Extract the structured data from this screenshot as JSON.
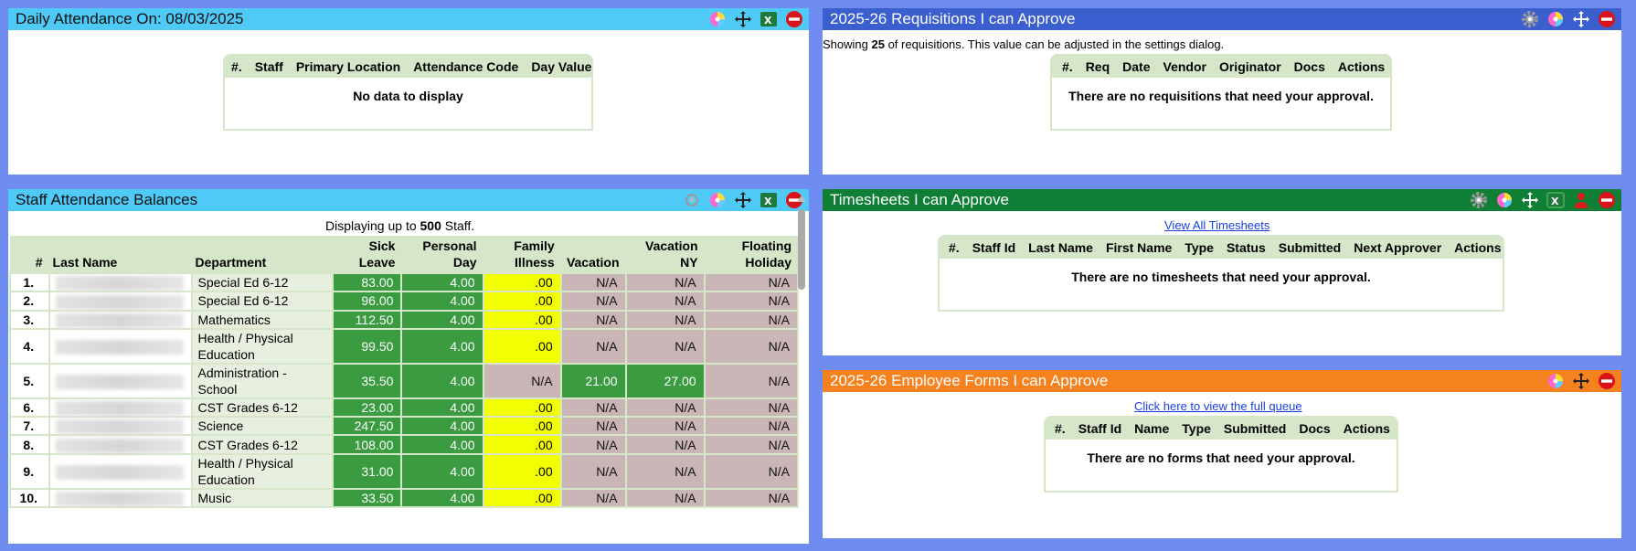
{
  "colors": {
    "frame": "#6f8df0",
    "cyan_header": "#4fc9f5",
    "blue_header": "#3b5fcf",
    "green_header": "#0f7f35",
    "orange_header": "#f5811f",
    "cell_green": "#3a9b41",
    "cell_yellow": "#f2ff00",
    "cell_mauve": "#c9b5b5",
    "table_header": "#d5e6c9"
  },
  "daily": {
    "title": "Daily Attendance On: 08/03/2025",
    "columns": [
      "#.",
      "Staff",
      "Primary Location",
      "Attendance Code",
      "Day Value"
    ],
    "empty": "No data to display",
    "icons": [
      "palette-icon",
      "move-icon",
      "excel-icon",
      "remove-icon"
    ]
  },
  "requisitions": {
    "title": "2025-26 Requisitions I can Approve",
    "note_prefix": "Showing ",
    "note_count": "25",
    "note_suffix": " of requisitions. This value can be adjusted in the settings dialog.",
    "columns": [
      "#.",
      "Req",
      "Date",
      "Vendor",
      "Originator",
      "Docs",
      "Actions"
    ],
    "empty": "There are no requisitions that need your approval.",
    "icons": [
      "gear-icon",
      "palette-icon",
      "move-icon",
      "remove-icon"
    ]
  },
  "balances": {
    "title": "Staff Attendance Balances",
    "note_prefix": "Displaying up to ",
    "note_count": "500",
    "note_suffix": " Staff.",
    "headers": {
      "num": "#",
      "last_name": "Last Name",
      "department": "Department",
      "sick_1": "Sick",
      "sick_2": "Leave",
      "personal_1": "Personal",
      "personal_2": "Day",
      "family_1": "Family",
      "family_2": "Illness",
      "vacation": "Vacation",
      "vac_ny_1": "Vacation",
      "vac_ny_2": "NY",
      "floating_1": "Floating",
      "floating_2": "Holiday"
    },
    "rows": [
      {
        "num": "1.",
        "dept": "Special Ed 6-12",
        "sick": "83.00",
        "personal": "4.00",
        "family": ".00",
        "vacation": "N/A",
        "vac_ny": "N/A",
        "floating": "N/A"
      },
      {
        "num": "2.",
        "dept": "Special Ed 6-12",
        "sick": "96.00",
        "personal": "4.00",
        "family": ".00",
        "vacation": "N/A",
        "vac_ny": "N/A",
        "floating": "N/A"
      },
      {
        "num": "3.",
        "dept": "Mathematics",
        "sick": "112.50",
        "personal": "4.00",
        "family": ".00",
        "vacation": "N/A",
        "vac_ny": "N/A",
        "floating": "N/A"
      },
      {
        "num": "4.",
        "dept": "Health / Physical Education",
        "sick": "99.50",
        "personal": "4.00",
        "family": ".00",
        "vacation": "N/A",
        "vac_ny": "N/A",
        "floating": "N/A"
      },
      {
        "num": "5.",
        "dept": "Administration - School",
        "sick": "35.50",
        "personal": "4.00",
        "family": "N/A",
        "vacation": "21.00",
        "vac_ny": "27.00",
        "floating": "N/A"
      },
      {
        "num": "6.",
        "dept": "CST Grades 6-12",
        "sick": "23.00",
        "personal": "4.00",
        "family": ".00",
        "vacation": "N/A",
        "vac_ny": "N/A",
        "floating": "N/A"
      },
      {
        "num": "7.",
        "dept": "Science",
        "sick": "247.50",
        "personal": "4.00",
        "family": ".00",
        "vacation": "N/A",
        "vac_ny": "N/A",
        "floating": "N/A"
      },
      {
        "num": "8.",
        "dept": "CST Grades 6-12",
        "sick": "108.00",
        "personal": "4.00",
        "family": ".00",
        "vacation": "N/A",
        "vac_ny": "N/A",
        "floating": "N/A"
      },
      {
        "num": "9.",
        "dept": "Health / Physical Education",
        "sick": "31.00",
        "personal": "4.00",
        "family": ".00",
        "vacation": "N/A",
        "vac_ny": "N/A",
        "floating": "N/A"
      },
      {
        "num": "10.",
        "dept": "Music",
        "sick": "33.50",
        "personal": "4.00",
        "family": ".00",
        "vacation": "N/A",
        "vac_ny": "N/A",
        "floating": "N/A"
      }
    ],
    "icons": [
      "settings-circle-icon",
      "palette-icon",
      "move-icon",
      "excel-icon",
      "remove-icon"
    ]
  },
  "timesheets": {
    "title": "Timesheets I can Approve",
    "link": "View All Timesheets",
    "columns": [
      "#.",
      "Staff Id",
      "Last Name",
      "First Name",
      "Type",
      "Status",
      "Submitted",
      "Next Approver",
      "Actions"
    ],
    "empty": "There are no timesheets that need your approval.",
    "icons": [
      "gear-icon",
      "palette-icon",
      "move-icon",
      "excel-icon",
      "person-icon",
      "remove-icon"
    ]
  },
  "forms": {
    "title": "2025-26 Employee Forms I can Approve",
    "link": "Click here to view the full queue",
    "columns": [
      "#.",
      "Staff Id",
      "Name",
      "Type",
      "Submitted",
      "Docs",
      "Actions"
    ],
    "empty": "There are no forms that need your approval.",
    "icons": [
      "palette-icon",
      "move-icon",
      "remove-icon"
    ]
  }
}
